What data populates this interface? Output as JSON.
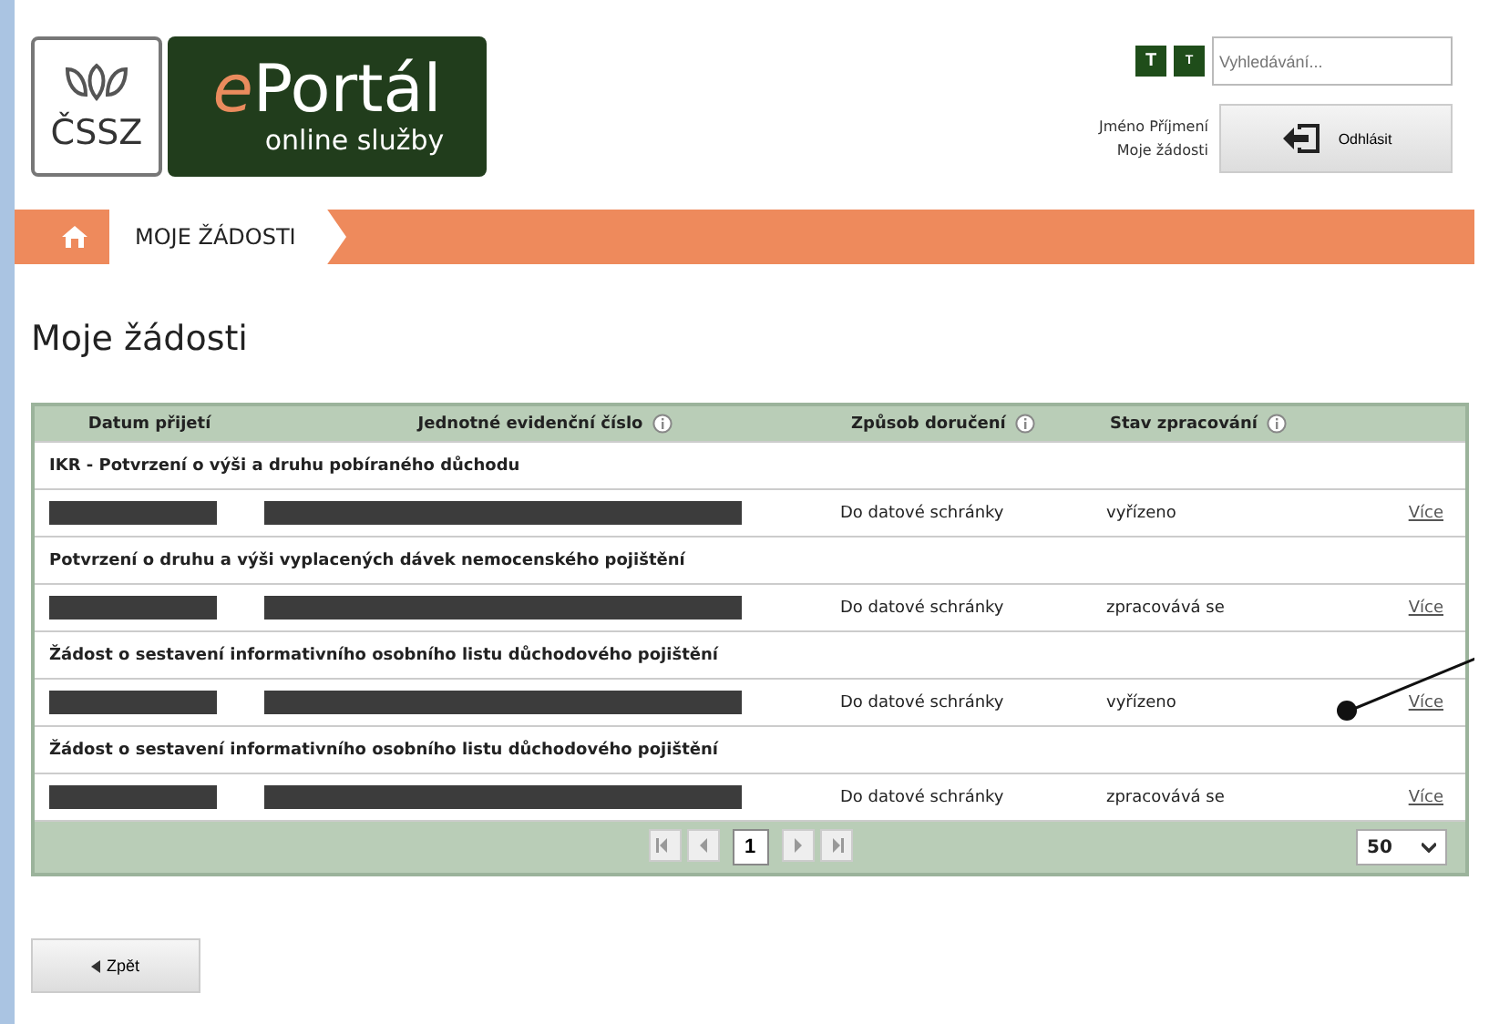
{
  "logo": {
    "abbr": "ČSSZ",
    "brand_prefix": "e",
    "brand_rest": "Portál",
    "subtitle": "online služby"
  },
  "header": {
    "font_buttons": [
      "T",
      "T"
    ],
    "search": {
      "placeholder": "Vyhledávání..."
    },
    "user_name": "Jméno Příjmení",
    "user_link": "Moje žádosti",
    "logout": "Odhlásit"
  },
  "breadcrumb": {
    "items": [
      "MOJE ŽÁDOSTI"
    ]
  },
  "page_title": "Moje žádosti",
  "table": {
    "columns": [
      {
        "label": "Datum přijetí",
        "info": false
      },
      {
        "label": "Jednotné evidenční číslo",
        "info": true
      },
      {
        "label": "Způsob doručení",
        "info": true
      },
      {
        "label": "Stav zpracování",
        "info": true
      }
    ],
    "rows": [
      {
        "title": "IKR - Potvrzení o výši a druhu pobíraného důchodu",
        "delivery": "Do datové schránky",
        "status": "vyřízeno",
        "link": "Více"
      },
      {
        "title": "Potvrzení o druhu a výši vyplacených dávek nemocenského pojištění",
        "delivery": "Do datové schránky",
        "status": "zpracovává se",
        "link": "Více"
      },
      {
        "title": "Žádost o sestavení informativního osobního listu důchodového pojištění",
        "delivery": "Do datové schránky",
        "status": "vyřízeno",
        "link": "Více"
      },
      {
        "title": "Žádost o sestavení informativního osobního listu důchodového pojištění",
        "delivery": "Do datové schránky",
        "status": "zpracovává se",
        "link": "Více"
      }
    ],
    "pagination": {
      "pages": [
        {
          "label": "1",
          "selected": true
        }
      ],
      "page_size": "50"
    }
  },
  "back_button": "Zpět"
}
